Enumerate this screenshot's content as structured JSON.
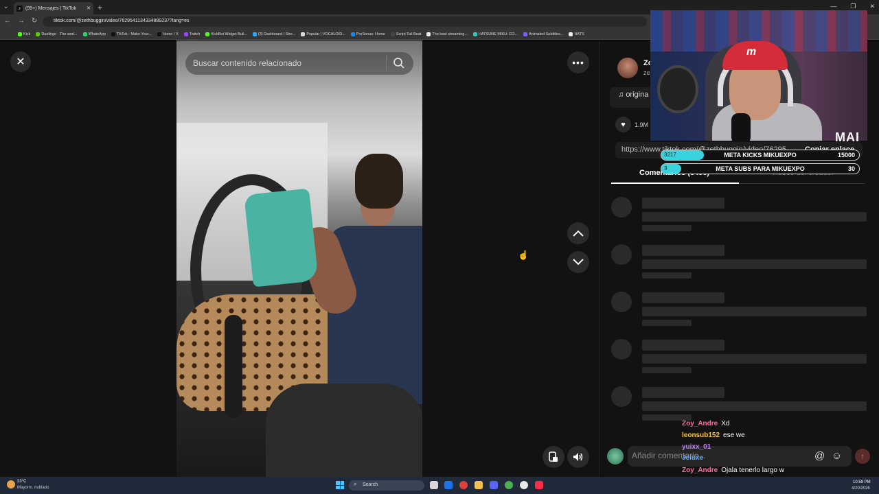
{
  "browser": {
    "tab_title": "(99+) Mensajes | TikTok",
    "url": "tiktok.com/@zethbuggin/video/7629541134334889237?lang=es",
    "bookmarks": [
      {
        "label": "Kick",
        "color": "#53fc18"
      },
      {
        "label": "Duolingo - The worl...",
        "color": "#58cc02"
      },
      {
        "label": "WhatsApp",
        "color": "#25d366"
      },
      {
        "label": "TikTok - Make Your...",
        "color": "#111111"
      },
      {
        "label": "Home / X",
        "color": "#111111"
      },
      {
        "label": "Twitch",
        "color": "#9146ff"
      },
      {
        "label": "KickBot Widget Buil...",
        "color": "#53fc18"
      },
      {
        "label": "(3) Dashboard / Stre...",
        "color": "#2aa7ff"
      },
      {
        "label": "Popular | VOCALOID...",
        "color": "#dddddd"
      },
      {
        "label": "PreSonus: Home",
        "color": "#1e88e5"
      },
      {
        "label": "Script Tail Beat",
        "color": "#444444"
      },
      {
        "label": "The best streaming...",
        "color": "#eeeeee"
      },
      {
        "label": "HATSUNE MIKU: CO...",
        "color": "#39c5bb"
      },
      {
        "label": "Animated Subtitles...",
        "color": "#7b5cff"
      },
      {
        "label": "HATS",
        "color": "#eeeeee"
      }
    ]
  },
  "video": {
    "search_placeholder": "Buscar contenido relacionado"
  },
  "panel": {
    "user_name": "Zo",
    "user_handle": "ze",
    "sound_label": "origina",
    "like_count": "1.9M",
    "link_url": "https://www.tiktok.com/@zethbuggin/video/76295...",
    "copy_link": "Copiar enlace",
    "tab_comments": "Comentarios (8496)",
    "tab_creator": "Videos del creador",
    "comment_placeholder": "Añadir comentario..."
  },
  "stream": {
    "logo": "MAI",
    "goals": [
      {
        "left": "3217",
        "label": "META KICKS MIKUEXPO",
        "right": "15000",
        "progress": 0.214
      },
      {
        "left": "3",
        "label": "META SUBS PARA MIKUEXPO",
        "right": "30",
        "progress": 0.1
      }
    ],
    "chat": [
      {
        "name": "Zoy_Andre",
        "color": "#ff6fa0",
        "text": "Xd"
      },
      {
        "name": "leonsub152",
        "color": "#f2c14e",
        "text": "ese we"
      },
      {
        "name": "yuixx_01",
        "color": "#c77dff",
        "text": ""
      },
      {
        "name": "Jeluxe",
        "color": "#5aa9ff",
        "text": ""
      },
      {
        "name": "Zoy_Andre",
        "color": "#ff6fa0",
        "text": "Ojala tenerlo largo w"
      }
    ]
  },
  "taskbar": {
    "temp": "23°C",
    "weather": "Mayorm. nublado",
    "search": "Search",
    "time": "10:59 PM",
    "date": "4/20/2026"
  }
}
